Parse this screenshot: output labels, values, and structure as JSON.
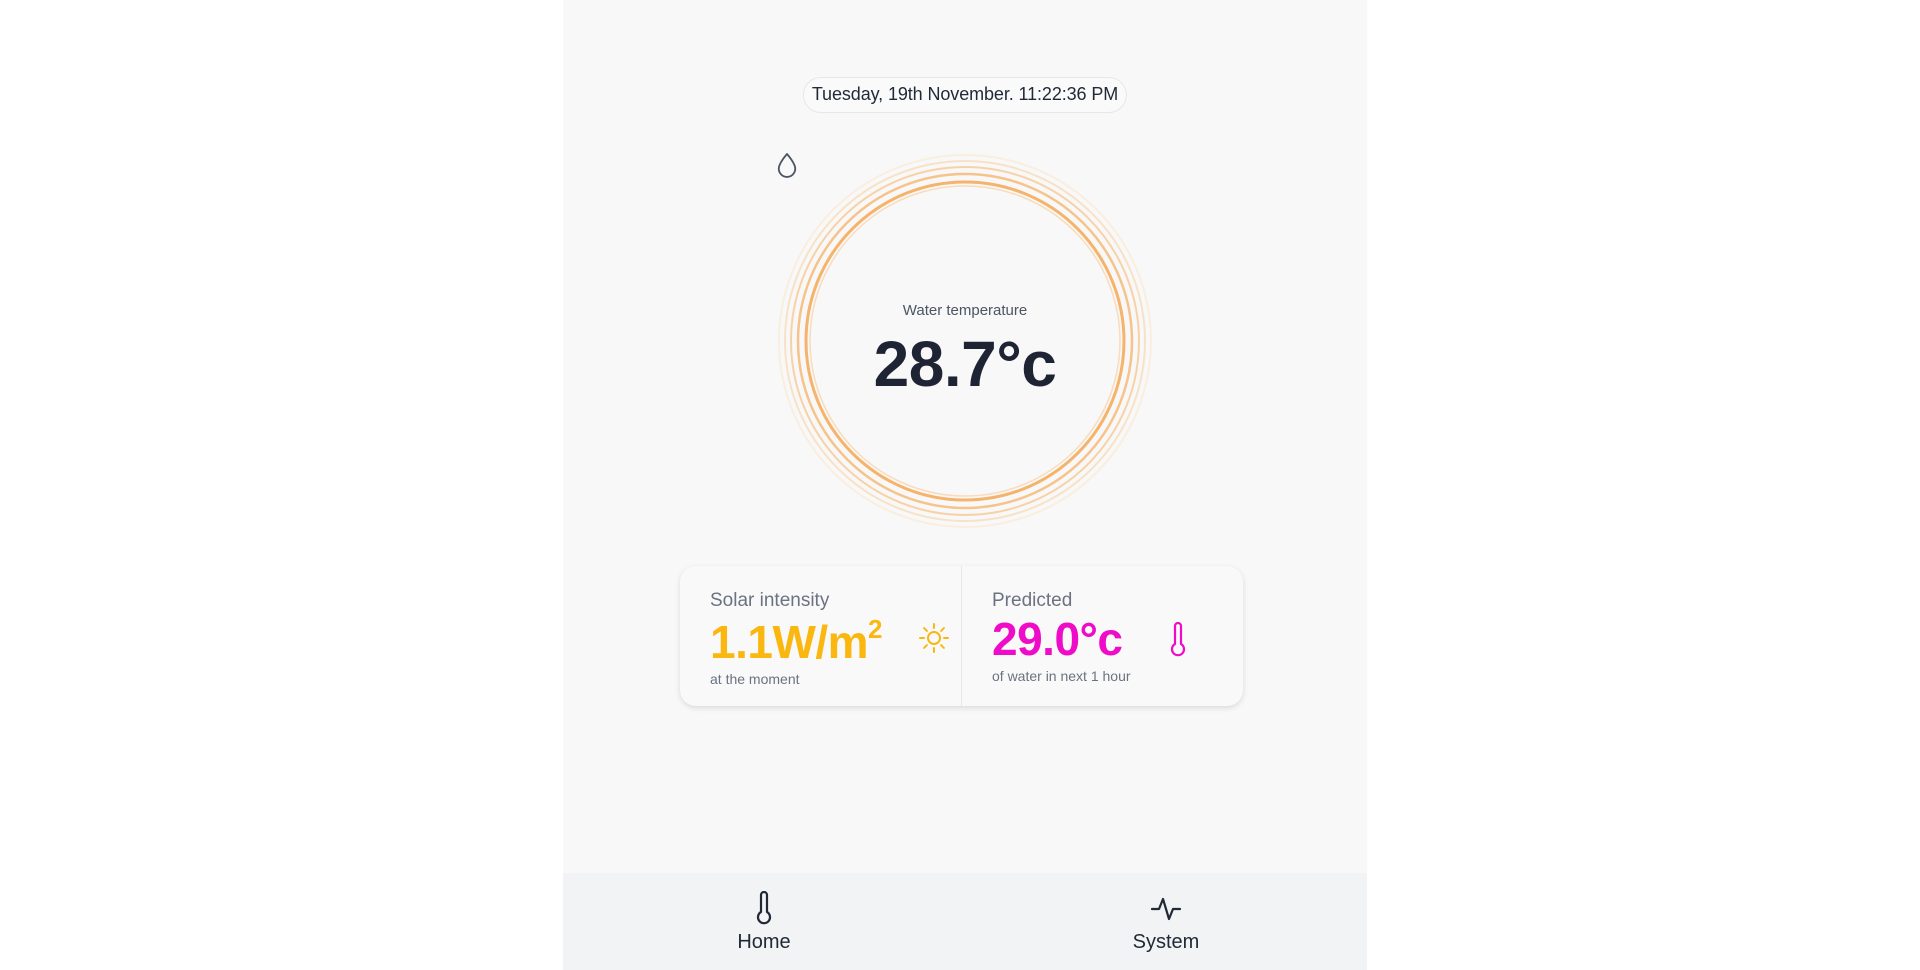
{
  "datetime": "Tuesday, 19th November. 11:22:36 PM",
  "gauge": {
    "icon": "water-drop-icon",
    "label": "Water temperature",
    "value": "28.7°c",
    "ring_color": "#f6b26b"
  },
  "cards": {
    "solar": {
      "title": "Solar intensity",
      "value": "1.1W/m",
      "superscript": "2",
      "subtitle": "at the moment",
      "icon": "sun-icon",
      "color": "#fab710"
    },
    "predicted": {
      "title": "Predicted",
      "value": "29.0°c",
      "subtitle": "of water in next 1 hour",
      "icon": "thermometer-icon",
      "color": "#ee0cc8"
    }
  },
  "nav": {
    "home": {
      "label": "Home",
      "icon": "thermometer-icon"
    },
    "system": {
      "label": "System",
      "icon": "activity-icon"
    }
  }
}
